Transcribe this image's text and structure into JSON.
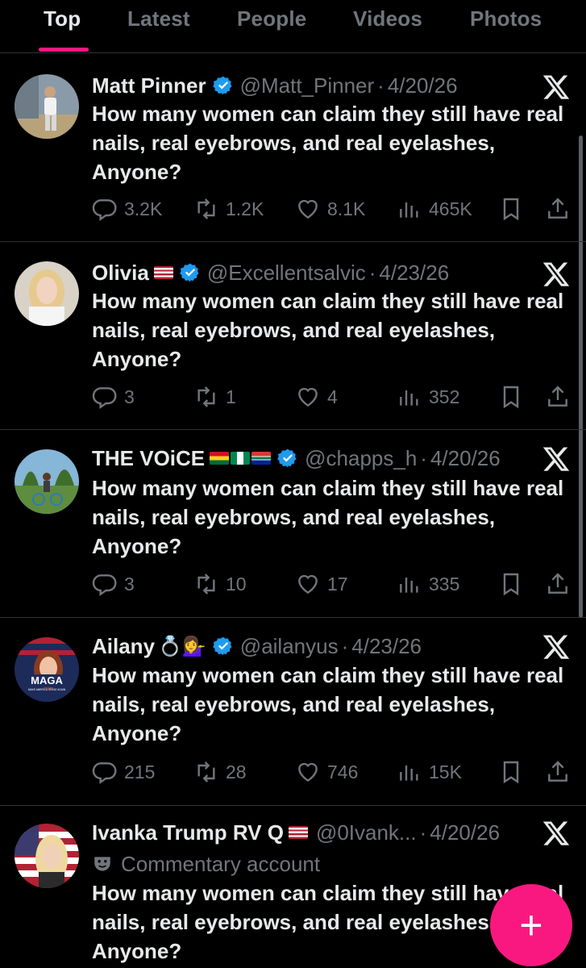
{
  "tabs": [
    {
      "label": "Top"
    },
    {
      "label": "Latest"
    },
    {
      "label": "People"
    },
    {
      "label": "Videos"
    },
    {
      "label": "Photos"
    }
  ],
  "colors": {
    "accent_pink": "#f91880",
    "verified_blue": "#1d9bf0",
    "text_primary": "#e7e9ea",
    "text_secondary": "#71767b",
    "background": "#000000"
  },
  "tweet_text": "How many women can claim they still have real nails, real eyebrows, and real eyelashes, Anyone?",
  "posts": [
    {
      "name": "Matt Pinner",
      "handle": "@Matt_Pinner",
      "date": "4/20/26",
      "text": "How many women can claim they still have real nails, real eyebrows, and real eyelashes, Anyone?",
      "replies": "3.2K",
      "reposts": "1.2K",
      "likes": "8.1K",
      "views": "465K"
    },
    {
      "name": "Olivia",
      "flags": "🇺🇸",
      "handle": "@Excellentsalvic",
      "date": "4/23/26",
      "text": "How many women can claim they still have real nails, real eyebrows, and real eyelashes, Anyone?",
      "replies": "3",
      "reposts": "1",
      "likes": "4",
      "views": "352"
    },
    {
      "name": "THE VOiCE",
      "flags": "🇬🇭🇳🇬🇿🇦",
      "handle": "@chapps_h",
      "date": "4/20/26",
      "text": "How many women can claim they still have real nails, real eyebrows, and real eyelashes, Anyone?",
      "replies": "3",
      "reposts": "10",
      "likes": "17",
      "views": "335"
    },
    {
      "name": "Ailany",
      "emojis": "💍💁‍♀️",
      "handle": "@ailanyus",
      "date": "4/23/26",
      "text": "How many women can claim they still have real nails, real eyebrows, and real eyelashes, Anyone?",
      "replies": "215",
      "reposts": "28",
      "likes": "746",
      "views": "15K",
      "avatar_badge": "MAGA",
      "avatar_badge_sub": "MAKE AMERICA GREAT AGAIN"
    },
    {
      "name": "Ivanka Trump RV Q",
      "flags": "🇺🇸",
      "handle": "@0Ivank...",
      "date": "4/20/26",
      "label": "Commentary account",
      "text": "How many women can claim they still have real nails, real eyebrows, and real eyelashes, Anyone?"
    }
  ],
  "fab": {
    "label": "+"
  }
}
